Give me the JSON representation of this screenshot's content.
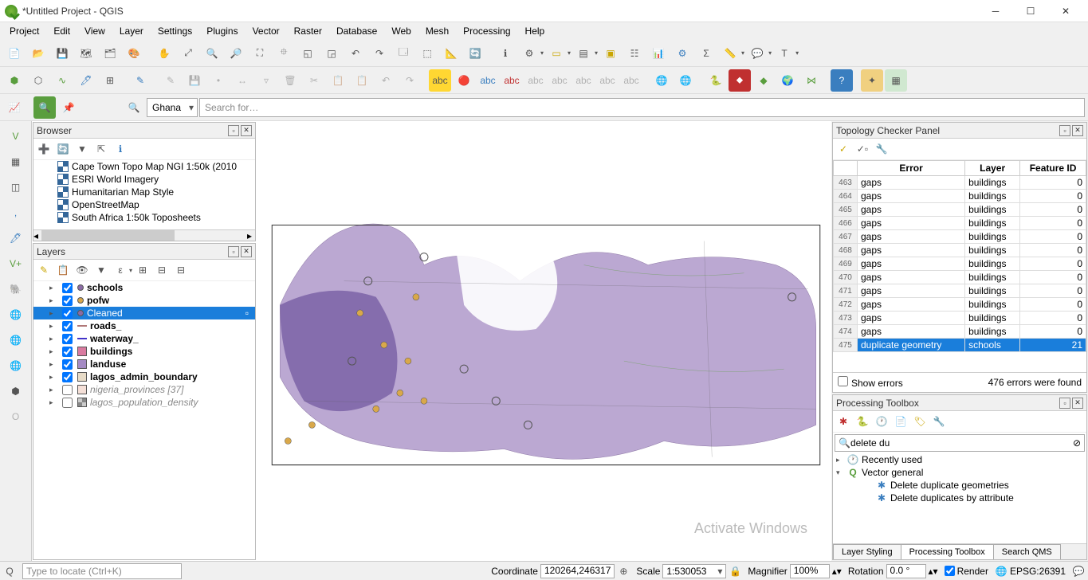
{
  "window": {
    "title": "*Untitled Project - QGIS"
  },
  "menu": [
    "Project",
    "Edit",
    "View",
    "Layer",
    "Settings",
    "Plugins",
    "Vector",
    "Raster",
    "Database",
    "Web",
    "Mesh",
    "Processing",
    "Help"
  ],
  "search_row": {
    "country": "Ghana",
    "search_placeholder": "Search for…"
  },
  "browser": {
    "title": "Browser",
    "items": [
      "Cape Town Topo Map NGI 1:50k (2010",
      "ESRI World Imagery",
      "Humanitarian Map Style",
      "OpenStreetMap",
      "South Africa 1:50k Toposheets"
    ]
  },
  "layers": {
    "title": "Layers",
    "items": [
      {
        "name": "schools",
        "checked": true,
        "type": "point",
        "color": "#8b6ba5",
        "bold": true
      },
      {
        "name": "pofw",
        "checked": true,
        "type": "point",
        "color": "#d9a84a",
        "bold": true
      },
      {
        "name": "Cleaned",
        "checked": true,
        "type": "point",
        "color": "#8b6ba5",
        "bold": false,
        "selected": true
      },
      {
        "name": "roads_",
        "checked": true,
        "type": "line",
        "color": "#b07878",
        "bold": true
      },
      {
        "name": "waterway_",
        "checked": true,
        "type": "line",
        "color": "#4233c9",
        "bold": true
      },
      {
        "name": "buildings",
        "checked": true,
        "type": "fill",
        "color": "#d97ba0",
        "bold": true
      },
      {
        "name": "landuse",
        "checked": true,
        "type": "fill",
        "color": "#a58bc4",
        "bold": true
      },
      {
        "name": "lagos_admin_boundary",
        "checked": true,
        "type": "fill",
        "color": "#e8dcc8",
        "bold": true
      },
      {
        "name": "nigeria_provinces [37]",
        "checked": false,
        "type": "fill",
        "color": "#f5e0d8",
        "bold": false,
        "italic": true
      },
      {
        "name": "lagos_population_density",
        "checked": false,
        "type": "raster",
        "color": "#888",
        "bold": false,
        "italic": true
      }
    ]
  },
  "topology": {
    "title": "Topology Checker Panel",
    "headers": {
      "error": "Error",
      "layer": "Layer",
      "feature": "Feature ID"
    },
    "rows": [
      {
        "n": 463,
        "error": "gaps",
        "layer": "buildings",
        "fid": 0,
        "partial": true
      },
      {
        "n": 464,
        "error": "gaps",
        "layer": "buildings",
        "fid": 0
      },
      {
        "n": 465,
        "error": "gaps",
        "layer": "buildings",
        "fid": 0
      },
      {
        "n": 466,
        "error": "gaps",
        "layer": "buildings",
        "fid": 0
      },
      {
        "n": 467,
        "error": "gaps",
        "layer": "buildings",
        "fid": 0
      },
      {
        "n": 468,
        "error": "gaps",
        "layer": "buildings",
        "fid": 0
      },
      {
        "n": 469,
        "error": "gaps",
        "layer": "buildings",
        "fid": 0
      },
      {
        "n": 470,
        "error": "gaps",
        "layer": "buildings",
        "fid": 0
      },
      {
        "n": 471,
        "error": "gaps",
        "layer": "buildings",
        "fid": 0
      },
      {
        "n": 472,
        "error": "gaps",
        "layer": "buildings",
        "fid": 0
      },
      {
        "n": 473,
        "error": "gaps",
        "layer": "buildings",
        "fid": 0
      },
      {
        "n": 474,
        "error": "gaps",
        "layer": "buildings",
        "fid": 0
      },
      {
        "n": 475,
        "error": "duplicate geometry",
        "layer": "schools",
        "fid": 21,
        "selected": true
      }
    ],
    "show_errors_label": "Show errors",
    "summary": "476 errors were found"
  },
  "processing": {
    "title": "Processing Toolbox",
    "search": "delete du",
    "tree": [
      {
        "label": "Recently used",
        "icon": "clock",
        "expand": "▸"
      },
      {
        "label": "Vector general",
        "icon": "qgis",
        "expand": "▾"
      },
      {
        "label": "Delete duplicate geometries",
        "icon": "gear",
        "indent": 2
      },
      {
        "label": "Delete duplicates by attribute",
        "icon": "gear",
        "indent": 2
      }
    ],
    "tabs": [
      "Layer Styling",
      "Processing Toolbox",
      "Search QMS"
    ],
    "active_tab": 1,
    "watermark": "Activate Windows"
  },
  "status": {
    "locator_placeholder": "Type to locate (Ctrl+K)",
    "coordinate_label": "Coordinate",
    "coordinate": "120264,246317",
    "scale_label": "Scale",
    "scale": "1:530053",
    "magnifier_label": "Magnifier",
    "magnifier": "100%",
    "rotation_label": "Rotation",
    "rotation": "0.0 °",
    "render_label": "Render",
    "crs": "EPSG:26391"
  }
}
